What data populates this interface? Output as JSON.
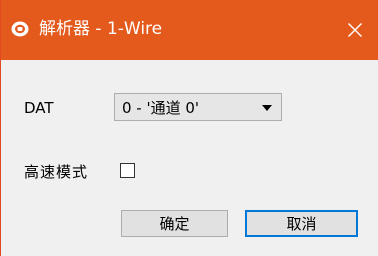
{
  "window": {
    "title": "解析器 - 1-Wire",
    "accent_color": "#e35a1c",
    "app_icon": "saleae-logo-icon",
    "close_icon": "close-icon"
  },
  "form": {
    "dat_label": "DAT",
    "dat_select_value": "0 - '通道 0'",
    "high_speed_label": "高速模式",
    "high_speed_checked": false
  },
  "buttons": {
    "ok_label": "确定",
    "cancel_label": "取消",
    "focus_color": "#0078d7"
  }
}
